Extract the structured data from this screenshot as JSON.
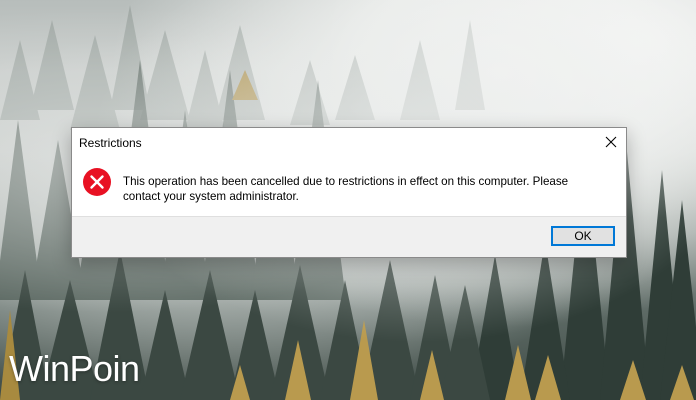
{
  "dialog": {
    "title": "Restrictions",
    "message": "This operation has been cancelled due to restrictions in effect on this computer. Please contact your system administrator.",
    "ok_label": "OK"
  },
  "watermark": "WinPoin",
  "icons": {
    "close": "close-icon",
    "error": "error-icon"
  },
  "colors": {
    "error_red": "#e81123",
    "button_border": "#0078d7",
    "footer_bg": "#f0f0f0"
  }
}
